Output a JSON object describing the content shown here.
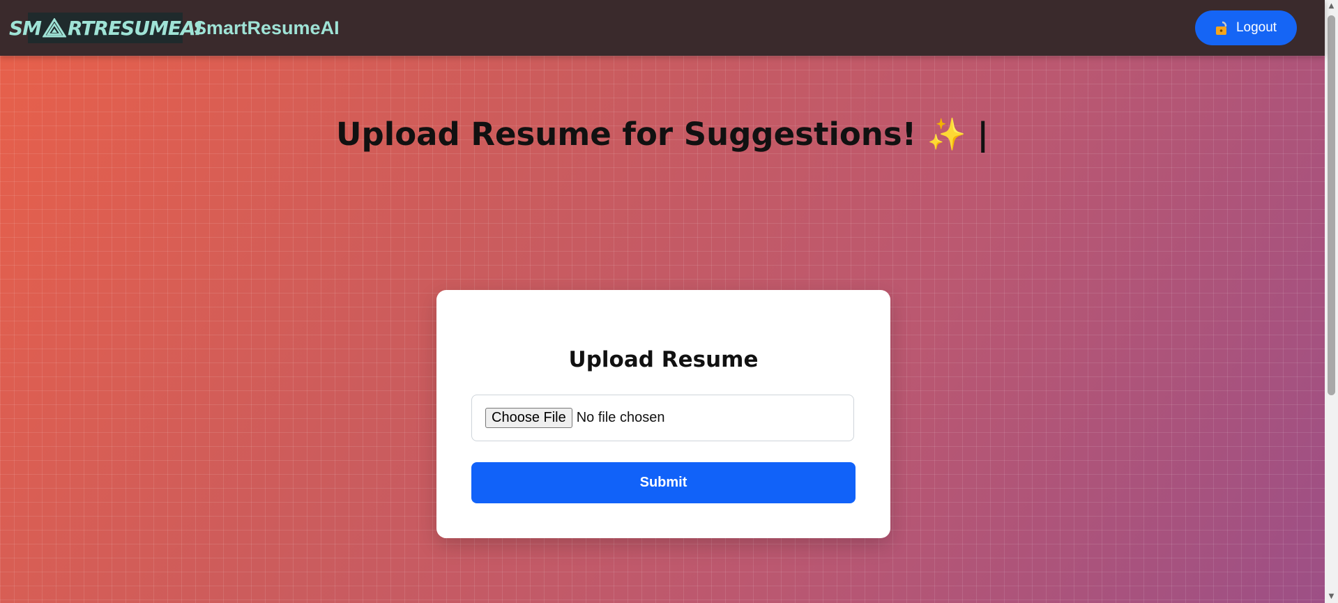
{
  "navbar": {
    "logo_text_left": "SM",
    "logo_text_right": "RTRESUMEAI",
    "brand_name": "SmartResumeAI",
    "logout_label": "Logout",
    "logout_icon": "unlock-icon"
  },
  "heading": {
    "text": "Upload Resume for Suggestions!",
    "sparkle": "✨",
    "cursor": "|"
  },
  "card": {
    "title": "Upload Resume",
    "file_button_label": "Choose File",
    "file_status": "No file chosen",
    "submit_label": "Submit"
  },
  "colors": {
    "navbar_bg": "#3a2a2c",
    "brand_teal": "#9fe3d6",
    "primary_blue": "#1162f9"
  }
}
